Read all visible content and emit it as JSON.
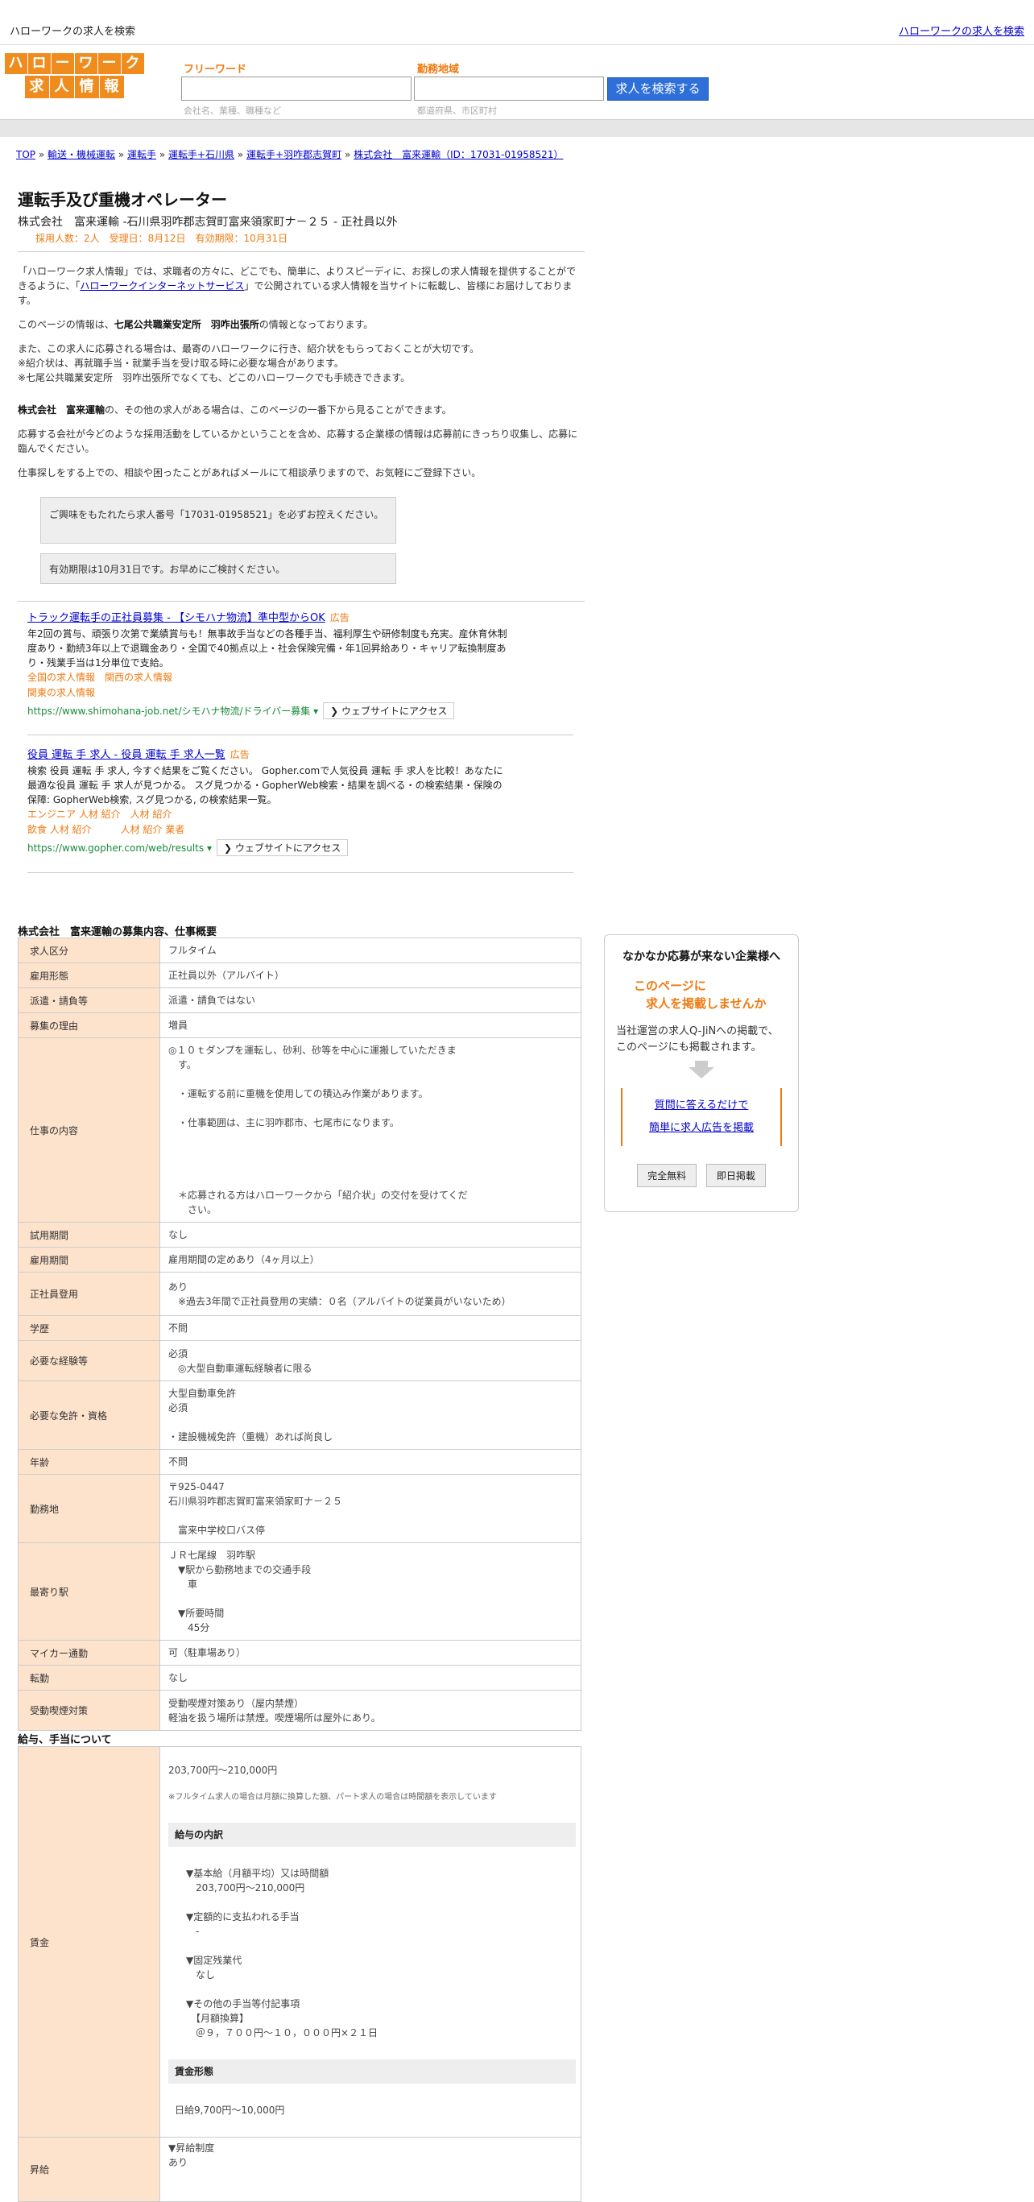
{
  "header": {
    "site_title": "ハローワークの求人を検索",
    "site_link": "ハローワークの求人を検索"
  },
  "logo": {
    "row1": [
      "ハ",
      "ロ",
      "ー",
      "ワ",
      "ー",
      "ク"
    ],
    "row2": [
      "求",
      "人",
      "情",
      "報"
    ]
  },
  "search": {
    "freeword_label": "フリーワード",
    "freeword_placeholder": "会社名、業種、職種など",
    "area_label": "勤務地域",
    "area_placeholder": "都道府県、市区町村",
    "button": "求人を検索する"
  },
  "breadcrumb": [
    "TOP",
    "輸送・機械運転",
    "運転手",
    "運転手+石川県",
    "運転手+羽咋郡志賀町",
    "株式会社　富来運輸（ID：17031-01958521）"
  ],
  "job": {
    "title": "運転手及び重機オペレーター",
    "company_line": "株式会社　富来運輸 -石川県羽咋郡志賀町富来領家町ナ－２５ - 正社員以外",
    "meta": "採用人数：2人　受理日：8月12日　有効期限：10月31日"
  },
  "intro": {
    "p1a": "「ハローワーク求人情報」では、求職者の方々に、どこでも、簡単に、よりスピーディに、お探しの求人情報を提供することができるように、「",
    "p1link": "ハローワークインターネットサービス",
    "p1b": "」で公開されている求人情報を当サイトに転載し、皆様にお届けしております。",
    "p2a": "このページの情報は、",
    "p2b": "七尾公共職業安定所　羽咋出張所",
    "p2c": "の情報となっております。",
    "p3": [
      "また、この求人に応募される場合は、最寄のハローワークに行き、紹介状をもらっておくことが大切です。",
      "※紹介状は、再就職手当・就業手当を受け取る時に必要な場合があります。",
      "※七尾公共職業安定所　羽咋出張所でなくても、どこのハローワークでも手続きできます。"
    ],
    "p4a": "株式会社　富来運輸",
    "p4b": "の、その他の求人がある場合は、このページの一番下から見ることができます。",
    "p5": "応募する会社が今どのような採用活動をしているかということを含め、応募する企業様の情報は応募前にきっちり収集し、応募に臨んでください。",
    "p6": "仕事探しをする上での、相談や困ったことがあればメールにて相談承りますので、お気軽にご登録下さい。",
    "note1": "ご興味をもたれたら求人番号「17031-01958521」を必ずお控えください。",
    "note2": "有効期限は10月31日です。お早めにご検討ください。"
  },
  "ads": [
    {
      "headline": "トラック運転手の正社員募集 - 【シモハナ物流】準中型からOK",
      "tag": "広告",
      "body": "年2回の賞与、頑張り次第で業績賞与も！無事故手当などの各種手当、福利厚生や研修制度も充実。産休育休制度あり・勤続3年以上で退職金あり・全国で40拠点以上・社会保険完備・年1回昇給あり・キャリア転換制度あり・残業手当は1分単位で支給。",
      "links": [
        "全国の求人情報",
        "関西の求人情報",
        "関東の求人情報"
      ],
      "url": "https://www.shimohana-job.net/シモハナ物流/ドライバー募集",
      "visit": "❯ ウェブサイトにアクセス"
    },
    {
      "headline": "役員 運転 手 求人 - 役員 運転 手 求人一覧",
      "tag": "広告",
      "body": "検索 役員 運転 手 求人, 今すぐ結果をご覧ください。 Gopher.comで人気役員 運転 手 求人を比較！あなたに最適な役員 運転 手 求人が見つかる。 スグ見つかる・GopherWeb検索・結果を調べる・の検索結果・保険の保障: GopherWeb検索, スグ見つかる, の検索結果一覧。",
      "links": [
        "エンジニア 人材 紹介",
        "人材 紹介",
        "飲食 人材 紹介",
        "人材 紹介 業者"
      ],
      "url": "https://www.gopher.com/web/results",
      "visit": "❯ ウェブサイトにアクセス"
    }
  ],
  "table_title": "株式会社　富来運輸の募集内容、仕事概要",
  "rows": [
    {
      "k": "求人区分",
      "v": "フルタイム"
    },
    {
      "k": "雇用形態",
      "v": "正社員以外（アルバイト）"
    },
    {
      "k": "派遣・請負等",
      "v": "派遣・請負ではない"
    },
    {
      "k": "募集の理由",
      "v": "増員"
    },
    {
      "k": "仕事の内容",
      "v": "◎１０ｔダンプを運転し、砂利、砂等を中心に運搬していただきま\n　す。\n\n　・運転する前に重機を使用しての積込み作業があります。\n\n　・仕事範囲は、主に羽咋郡市、七尾市になります。\n\n\n\n\n　＊応募される方はハローワークから「紹介状」の交付を受けてくだ\n　　さい。"
    },
    {
      "k": "試用期間",
      "v": "なし"
    },
    {
      "k": "雇用期間",
      "v": "雇用期間の定めあり（4ヶ月以上）"
    },
    {
      "k": "正社員登用",
      "v": "あり\n　※過去3年間で正社員登用の実績：０名（アルバイトの従業員がいないため）"
    },
    {
      "k": "学歴",
      "v": "不問"
    },
    {
      "k": "必要な経験等",
      "v": "必須\n　◎大型自動車運転経験者に限る"
    },
    {
      "k": "必要な免許・資格",
      "v": "大型自動車免許\n必須\n\n・建設機械免許（重機）あれば尚良し"
    },
    {
      "k": "年齢",
      "v": "不問"
    },
    {
      "k": "勤務地",
      "v": "〒925-0447\n石川県羽咋郡志賀町富来領家町ナ－２５\n\n　富来中学校口バス停"
    },
    {
      "k": "最寄り駅",
      "v": "ＪＲ七尾線　羽咋駅\n　▼駅から勤務地までの交通手段\n　　車\n\n　▼所要時間\n　　45分"
    },
    {
      "k": "マイカー通勤",
      "v": "可（駐車場あり）"
    },
    {
      "k": "転勤",
      "v": "なし"
    },
    {
      "k": "受動喫煙対策",
      "v": "受動喫煙対策あり（屋内禁煙）\n軽油を扱う場所は禁煙。喫煙場所は屋外にあり。"
    }
  ],
  "salary_title": "給与、手当について",
  "salary": {
    "k": "賃金",
    "range": "203,700円〜210,000円",
    "note": "※フルタイム求人の場合は月額に換算した額、パート求人の場合は時間額を表示しています",
    "breakdown_h": "給与の内訳",
    "breakdown": "▼基本給（月額平均）又は時間額\n　203,700円〜210,000円\n\n▼定額的に支払われる手当\n　-\n\n▼固定残業代\n　なし\n\n▼その他の手当等付記事項\n　【月額換算】\n　＠９，７００円～１０，０００円×２１日",
    "form_h": "賃金形態",
    "form": "日給9,700円〜10,000円"
  },
  "raise": {
    "k": "昇給",
    "v": "▼昇給制度\nあり"
  },
  "side": {
    "title": "なかなか応募が来ない企業様へ",
    "catch1": "このページに",
    "catch2": "　求人を掲載しませんか",
    "desc1": "当社運営の求人Q-JiNへの掲載で、",
    "desc2": "このページにも掲載されます。",
    "link1": "質問に答えるだけで",
    "link2": "簡単に求人広告を掲載",
    "btn1": "完全無料",
    "btn2": "即日掲載"
  },
  "colors": {
    "accent": "#ef7a10",
    "th_bg": "#fde2cc",
    "button": "#2e6fd8"
  }
}
